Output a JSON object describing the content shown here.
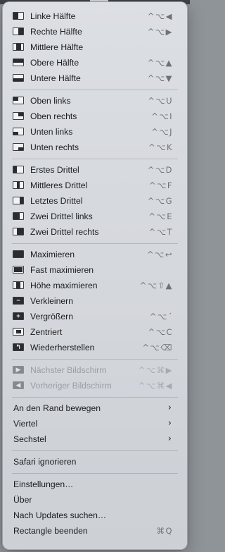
{
  "menu": {
    "sections": [
      {
        "items": [
          {
            "label": "Linke Hälfte",
            "shortcut": "^⌥◀",
            "icon": "left-half-icon",
            "fill": "left"
          },
          {
            "label": "Rechte Hälfte",
            "shortcut": "^⌥▶",
            "icon": "right-half-icon",
            "fill": "right"
          },
          {
            "label": "Mittlere Hälfte",
            "shortcut": "",
            "icon": "center-half-icon",
            "fill": "centerhalf"
          },
          {
            "label": "Obere Hälfte",
            "shortcut": "^⌥▲",
            "icon": "top-half-icon",
            "fill": "top"
          },
          {
            "label": "Untere Hälfte",
            "shortcut": "^⌥▼",
            "icon": "bottom-half-icon",
            "fill": "bottom"
          }
        ]
      },
      {
        "items": [
          {
            "label": "Oben links",
            "shortcut": "^⌥U",
            "icon": "top-left-icon",
            "fill": "tl"
          },
          {
            "label": "Oben rechts",
            "shortcut": "^⌥I",
            "icon": "top-right-icon",
            "fill": "tr"
          },
          {
            "label": "Unten links",
            "shortcut": "^⌥J",
            "icon": "bottom-left-icon",
            "fill": "bl"
          },
          {
            "label": "Unten rechts",
            "shortcut": "^⌥K",
            "icon": "bottom-right-icon",
            "fill": "br"
          }
        ]
      },
      {
        "items": [
          {
            "label": "Erstes Drittel",
            "shortcut": "^⌥D",
            "icon": "first-third-icon",
            "fill": "third1"
          },
          {
            "label": "Mittleres Drittel",
            "shortcut": "^⌥F",
            "icon": "center-third-icon",
            "fill": "third2"
          },
          {
            "label": "Letztes Drittel",
            "shortcut": "^⌥G",
            "icon": "last-third-icon",
            "fill": "third3"
          },
          {
            "label": "Zwei Drittel links",
            "shortcut": "^⌥E",
            "icon": "two-thirds-left-icon",
            "fill": "twothirdsL"
          },
          {
            "label": "Zwei Drittel rechts",
            "shortcut": "^⌥T",
            "icon": "two-thirds-right-icon",
            "fill": "twothirdsR"
          }
        ]
      },
      {
        "items": [
          {
            "label": "Maximieren",
            "shortcut": "^⌥↩",
            "icon": "maximize-icon",
            "fill": "full"
          },
          {
            "label": "Fast maximieren",
            "shortcut": "",
            "icon": "almost-maximize-icon",
            "fill": "almost"
          },
          {
            "label": "Höhe maximieren",
            "shortcut": "^⌥⇧▲",
            "icon": "maximize-height-icon",
            "fill": "height"
          },
          {
            "label": "Verkleinern",
            "shortcut": "",
            "icon": "make-smaller-icon",
            "glyph": "−"
          },
          {
            "label": "Vergrößern",
            "shortcut": "^⌥´",
            "icon": "make-larger-icon",
            "glyph": "+"
          },
          {
            "label": "Zentriert",
            "shortcut": "^⌥C",
            "icon": "center-icon",
            "fill": "center"
          },
          {
            "label": "Wiederherstellen",
            "shortcut": "^⌥⌫",
            "icon": "restore-icon",
            "glyph": "↰"
          }
        ]
      },
      {
        "items": [
          {
            "label": "Nächster Bildschirm",
            "shortcut": "^⌥⌘▶",
            "icon": "next-display-icon",
            "glyph": "▶",
            "disabled": true
          },
          {
            "label": "Vorheriger Bildschirm",
            "shortcut": "^⌥⌘◀",
            "icon": "previous-display-icon",
            "glyph": "◀",
            "disabled": true
          }
        ]
      },
      {
        "items": [
          {
            "label": "An den Rand bewegen",
            "submenu": true
          },
          {
            "label": "Viertel",
            "submenu": true
          },
          {
            "label": "Sechstel",
            "submenu": true
          }
        ]
      },
      {
        "items": [
          {
            "label": "Safari ignorieren"
          }
        ]
      },
      {
        "items": [
          {
            "label": "Einstellungen…"
          },
          {
            "label": "Über"
          },
          {
            "label": "Nach Updates suchen…"
          },
          {
            "label": "Rectangle beenden",
            "shortcut": "⌘Q"
          }
        ]
      }
    ],
    "chevron": "›"
  }
}
